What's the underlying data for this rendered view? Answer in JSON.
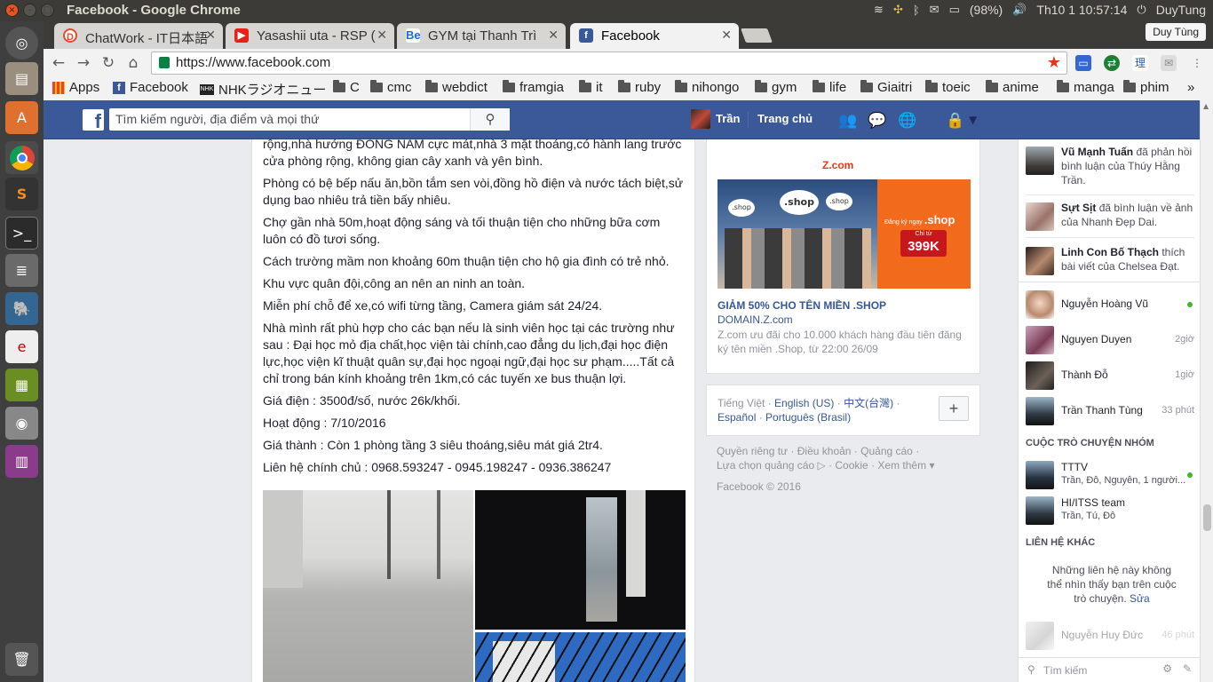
{
  "os": {
    "window_title": "Facebook - Google Chrome",
    "battery": "(98%)",
    "clock": "Th10 1 10:57:14",
    "user": "DuyTung"
  },
  "browser": {
    "tabs": [
      {
        "label": "ChatWork - IT日本語",
        "favicon": "chatwork-icon",
        "active": false
      },
      {
        "label": "Yasashii uta - RSP (",
        "favicon": "youtube-icon",
        "active": false
      },
      {
        "label": "GYM tại Thanh Trì",
        "favicon": "behance-icon",
        "active": false
      },
      {
        "label": "Facebook",
        "favicon": "facebook-icon",
        "active": true
      }
    ],
    "profile_button": "Duy Tùng",
    "url": "https://www.facebook.com",
    "bookmarks": [
      "Apps",
      "Facebook",
      "NHKラジオニュー",
      "C",
      "cmc",
      "webdict",
      "framgia",
      "it",
      "ruby",
      "nihongo",
      "gym",
      "life",
      "Giaitri",
      "toeic",
      "anime",
      "manga",
      "phim"
    ],
    "bookmarks_more": "»"
  },
  "fb": {
    "search_placeholder": "Tìm kiếm người, địa điểm và mọi thứ",
    "profile_name": "Trần",
    "home": "Trang chủ",
    "brand_color": "#3b5998"
  },
  "post": {
    "paragraphs": [
      "rộng,nhà hướng ĐÔNG NAM cực mát,nhà 3 mặt thoáng,có hành lang trước cửa phòng rộng, không gian cây xanh và yên bình.",
      "Phòng có bệ bếp nấu ăn,bồn tắm sen vòi,đồng hồ điện và nước tách biệt,sử dụng bao nhiêu trả tiền bấy nhiêu.",
      "Chợ gần nhà 50m,hoạt động sáng và tối thuận tiện cho những bữa cơm luôn có đồ tươi sống.",
      "Cách trường mầm non khoảng 60m thuận tiện cho hộ gia đình có trẻ nhỏ.",
      "Khu vực quân đội,công an nên an ninh an toàn.",
      "Miễn phí chỗ để xe,có wifi từng tầng, Camera giám sát 24/24.",
      "Nhà mình rất phù hợp cho các bạn nếu là sinh viên học tại các trường như sau : Đại học mỏ địa chất,học viện tài chính,cao đẳng du lịch,đại học điện lực,học viện kĩ thuật quân sự,đại học ngoại ngữ,đại học sư phạm.....Tất cả chỉ trong bán kính khoảng trên 1km,có các tuyến xe bus thuận lợi.",
      "Giá điện : 3500đ/số, nước 26k/khối.",
      "Hoạt động : 7/10/2016",
      "Giá thành : Còn 1 phòng tầng 3 siêu thoáng,siêu mát giá 2tr4.",
      "Liên hệ chính chủ : 0968.593247 - 0945.198247 - 0936.386247"
    ]
  },
  "ad": {
    "brand": "Z.com",
    "banner_cta": "Đăng ký ngay",
    "banner_shop": ".shop",
    "banner_price_prefix": "Chỉ từ",
    "banner_price": "399K",
    "title": "GIẢM 50% CHO TÊN MIỀN .SHOP",
    "domain": "DOMAIN.Z.com",
    "desc": "Z.com ưu đãi cho 10.000 khách hàng đầu tiên đăng ký tên miền .Shop, từ 22:00 26/09"
  },
  "languages": {
    "current": "Tiếng Việt",
    "others": [
      "English (US)",
      "中文(台灣)",
      "Español",
      "Português (Brasil)"
    ],
    "plus": "+"
  },
  "footer": {
    "links": [
      "Quyền riêng tư",
      "Điều khoản",
      "Quảng cáo",
      "Lựa chọn quảng cáo",
      "Cookie",
      "Xem thêm"
    ],
    "copyright": "Facebook © 2016"
  },
  "ticker": [
    {
      "name": "Vũ Mạnh Tuấn",
      "text": "đã phản hồi bình luận của Thúy Hằng Trần."
    },
    {
      "name": "Sựt Sịt",
      "text": "đã bình luận về ảnh của Nhanh Đẹp Dai."
    },
    {
      "name": "Linh Con Bố Thạch",
      "text": "thích bài viết của Chelsea Đạt."
    }
  ],
  "contacts": [
    {
      "name": "Nguyễn Hoàng Vũ",
      "status": ""
    },
    {
      "name": "Nguyen Duyen",
      "status": "2giờ"
    },
    {
      "name": "Thành Đỗ",
      "status": "1giờ"
    },
    {
      "name": "Trần Thanh Tùng",
      "status": "33 phút"
    }
  ],
  "group_header": "CUỘC TRÒ CHUYỆN NHÓM",
  "groups": [
    {
      "name": "TTTV",
      "members": "Trần, Đỗ, Nguyễn, 1 người..."
    },
    {
      "name": "HI/ITSS team",
      "members": "Trần, Tú, Đỗ"
    }
  ],
  "other_header": "LIÊN HỆ KHÁC",
  "other_note": "Những liên hệ này không thể nhìn thấy bạn trên cuộc trò chuyện.",
  "other_edit": "Sửa",
  "faded_contact": {
    "name": "Nguyễn Huy Đức",
    "status": "46 phút"
  },
  "chat_search": "Tìm kiếm"
}
